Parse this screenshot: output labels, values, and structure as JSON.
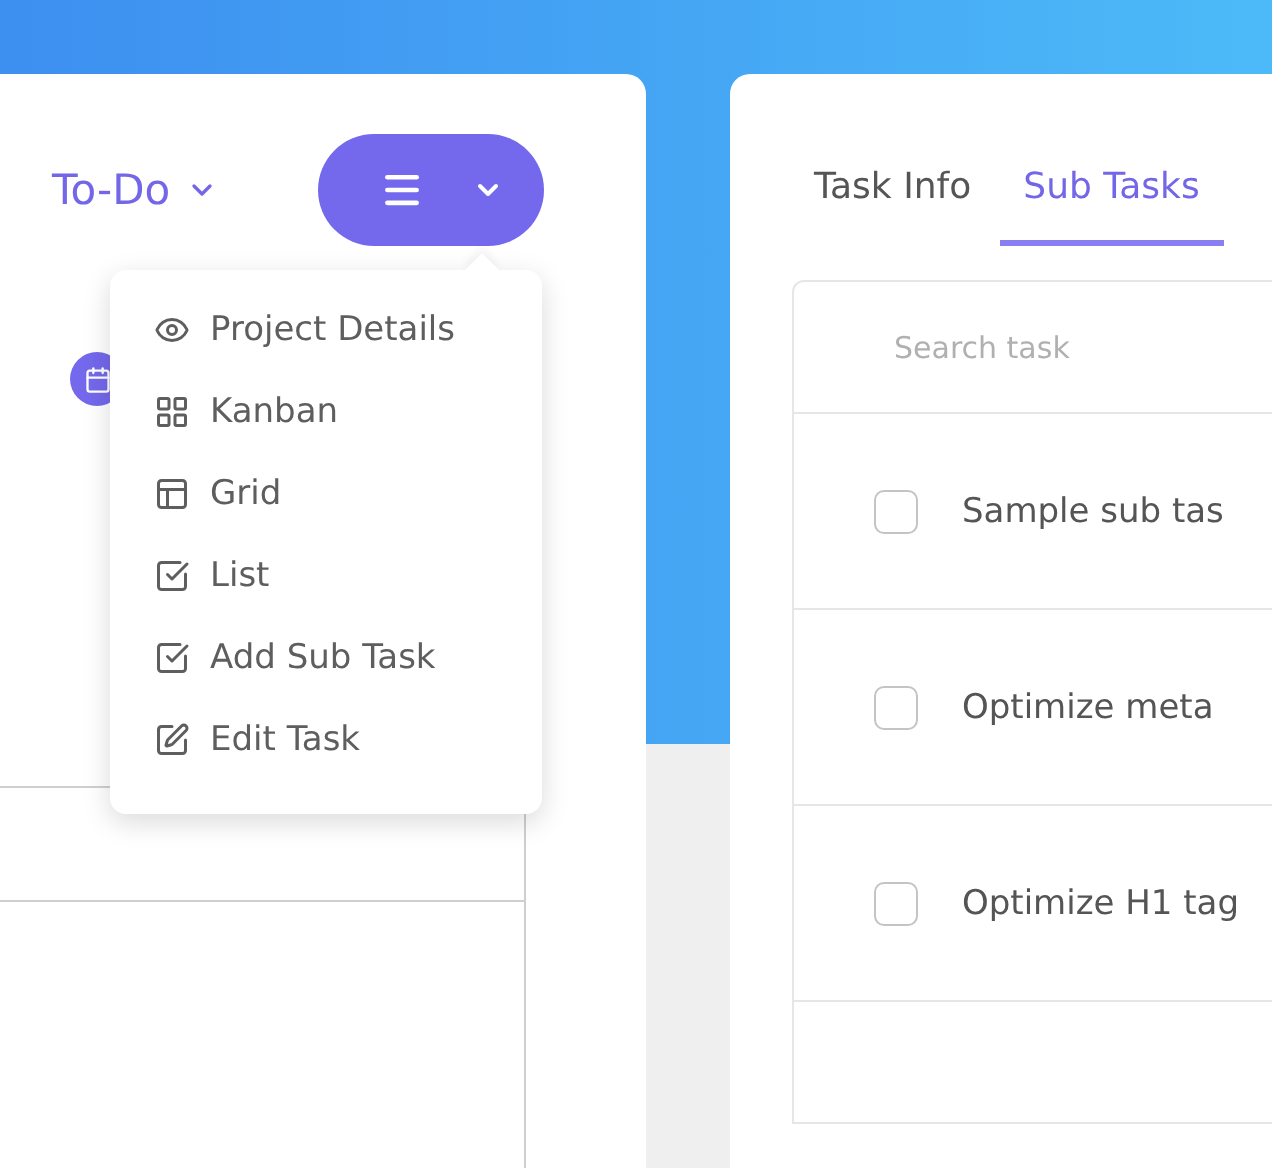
{
  "board": {
    "status": "To-Do"
  },
  "view_menu": {
    "items": [
      {
        "label": "Project Details"
      },
      {
        "label": "Kanban"
      },
      {
        "label": "Grid"
      },
      {
        "label": "List"
      },
      {
        "label": "Add Sub Task"
      },
      {
        "label": "Edit Task"
      }
    ]
  },
  "tabs": [
    {
      "label": "Task Info",
      "selected": false
    },
    {
      "label": "Sub Tasks",
      "selected": true
    }
  ],
  "search": {
    "placeholder": "Search task"
  },
  "subtasks": [
    {
      "title": "Sample sub tas",
      "checked": false
    },
    {
      "title": "Optimize meta",
      "checked": false
    },
    {
      "title": "Optimize H1 tag",
      "checked": false
    }
  ]
}
